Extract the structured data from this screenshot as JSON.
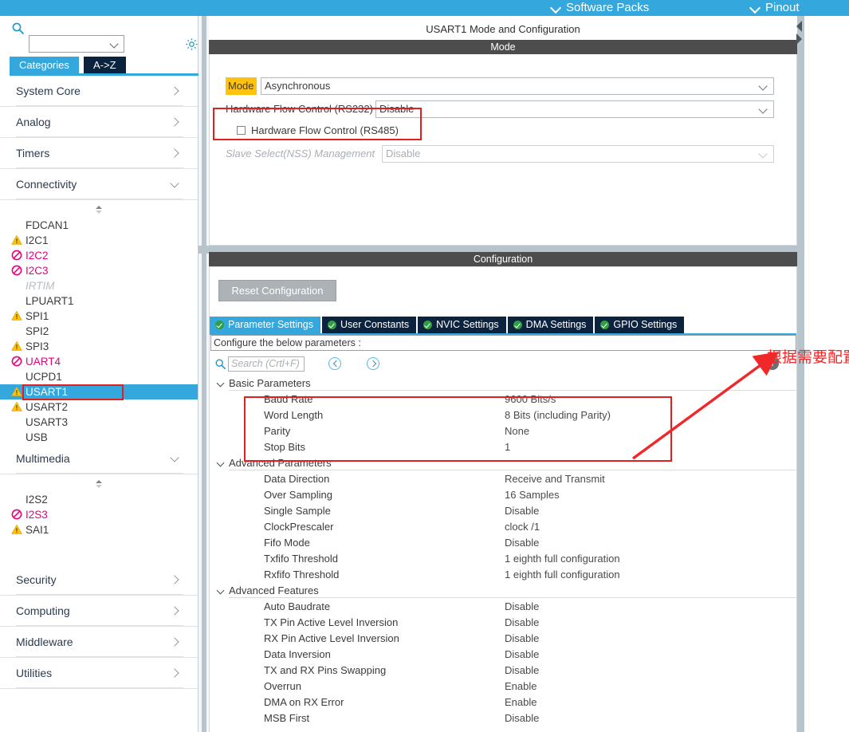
{
  "topbar": {
    "software_packs": "Software Packs",
    "pinout": "Pinout"
  },
  "sidebar": {
    "search_placeholder": "",
    "search_value": "",
    "tabs": [
      {
        "label": "Categories",
        "active": true
      },
      {
        "label": "A->Z",
        "active": false
      }
    ],
    "categories": [
      {
        "label": "System Core",
        "expanded": false
      },
      {
        "label": "Analog",
        "expanded": false
      },
      {
        "label": "Timers",
        "expanded": false
      },
      {
        "label": "Connectivity",
        "expanded": true
      }
    ],
    "connectivity_items": [
      {
        "label": "FDCAN1",
        "status": "none"
      },
      {
        "label": "I2C1",
        "status": "warning"
      },
      {
        "label": "I2C2",
        "status": "error"
      },
      {
        "label": "I2C3",
        "status": "error"
      },
      {
        "label": "IRTIM",
        "status": "disabled"
      },
      {
        "label": "LPUART1",
        "status": "none"
      },
      {
        "label": "SPI1",
        "status": "warning"
      },
      {
        "label": "SPI2",
        "status": "none"
      },
      {
        "label": "SPI3",
        "status": "warning"
      },
      {
        "label": "UART4",
        "status": "error"
      },
      {
        "label": "UCPD1",
        "status": "none"
      },
      {
        "label": "USART1",
        "status": "warning",
        "selected": true
      },
      {
        "label": "USART2",
        "status": "warning"
      },
      {
        "label": "USART3",
        "status": "none"
      },
      {
        "label": "USB",
        "status": "none"
      }
    ],
    "multimedia": {
      "label": "Multimedia",
      "expanded": true
    },
    "multimedia_items": [
      {
        "label": "I2S2",
        "status": "none"
      },
      {
        "label": "I2S3",
        "status": "error"
      },
      {
        "label": "SAI1",
        "status": "warning"
      }
    ],
    "categories_bottom": [
      {
        "label": "Security",
        "expanded": false
      },
      {
        "label": "Computing",
        "expanded": false
      },
      {
        "label": "Middleware",
        "expanded": false
      },
      {
        "label": "Utilities",
        "expanded": false
      }
    ]
  },
  "main": {
    "panel_title": "USART1 Mode and Configuration",
    "mode": {
      "header": "Mode",
      "mode_label": "Mode",
      "mode_value": "Asynchronous",
      "flow_rs232_label": "Hardware Flow Control (RS232)",
      "flow_rs232_value": "Disable",
      "flow_rs485_label": "Hardware Flow Control (RS485)",
      "flow_rs485_checked": false,
      "nss_label": "Slave Select(NSS) Management",
      "nss_value": "Disable"
    },
    "configuration": {
      "header": "Configuration",
      "reset_button": "Reset Configuration",
      "tabs": [
        {
          "label": "Parameter Settings",
          "active": true
        },
        {
          "label": "User Constants",
          "active": false
        },
        {
          "label": "NVIC Settings",
          "active": false
        },
        {
          "label": "DMA Settings",
          "active": false
        },
        {
          "label": "GPIO Settings",
          "active": false
        }
      ],
      "subtitle": "Configure the below parameters :",
      "search_placeholder": "Search (Crtl+F)",
      "search_value": "",
      "groups": [
        {
          "label": "Basic Parameters",
          "expanded": true,
          "params": [
            {
              "name": "Baud Rate",
              "value": "9600 Bits/s"
            },
            {
              "name": "Word Length",
              "value": "8 Bits (including Parity)"
            },
            {
              "name": "Parity",
              "value": "None"
            },
            {
              "name": "Stop Bits",
              "value": "1"
            }
          ]
        },
        {
          "label": "Advanced Parameters",
          "expanded": true,
          "params": [
            {
              "name": "Data Direction",
              "value": "Receive and Transmit"
            },
            {
              "name": "Over Sampling",
              "value": "16 Samples"
            },
            {
              "name": "Single Sample",
              "value": "Disable"
            },
            {
              "name": "ClockPrescaler",
              "value": "clock /1"
            },
            {
              "name": "Fifo Mode",
              "value": "Disable"
            },
            {
              "name": "Txfifo Threshold",
              "value": "1 eighth full configuration"
            },
            {
              "name": "Rxfifo Threshold",
              "value": "1 eighth full configuration"
            }
          ]
        },
        {
          "label": "Advanced Features",
          "expanded": true,
          "params": [
            {
              "name": "Auto Baudrate",
              "value": "Disable"
            },
            {
              "name": "TX Pin Active Level Inversion",
              "value": "Disable"
            },
            {
              "name": "RX Pin Active Level Inversion",
              "value": "Disable"
            },
            {
              "name": "Data Inversion",
              "value": "Disable"
            },
            {
              "name": "TX and RX Pins Swapping",
              "value": "Disable"
            },
            {
              "name": "Overrun",
              "value": "Enable"
            },
            {
              "name": "DMA on RX Error",
              "value": "Enable"
            },
            {
              "name": "MSB First",
              "value": "Disable"
            }
          ]
        }
      ]
    }
  },
  "annotation": {
    "text": "根据需要配置即可",
    "color": "#ef2929"
  },
  "colors": {
    "accent_blue": "#34a8dd",
    "tab_dark": "#0c2340",
    "header_gray": "#4d4d4d",
    "warning_yellow": "#ffc20e",
    "error_pink": "#e8007d",
    "annotation_red": "#e02020"
  }
}
